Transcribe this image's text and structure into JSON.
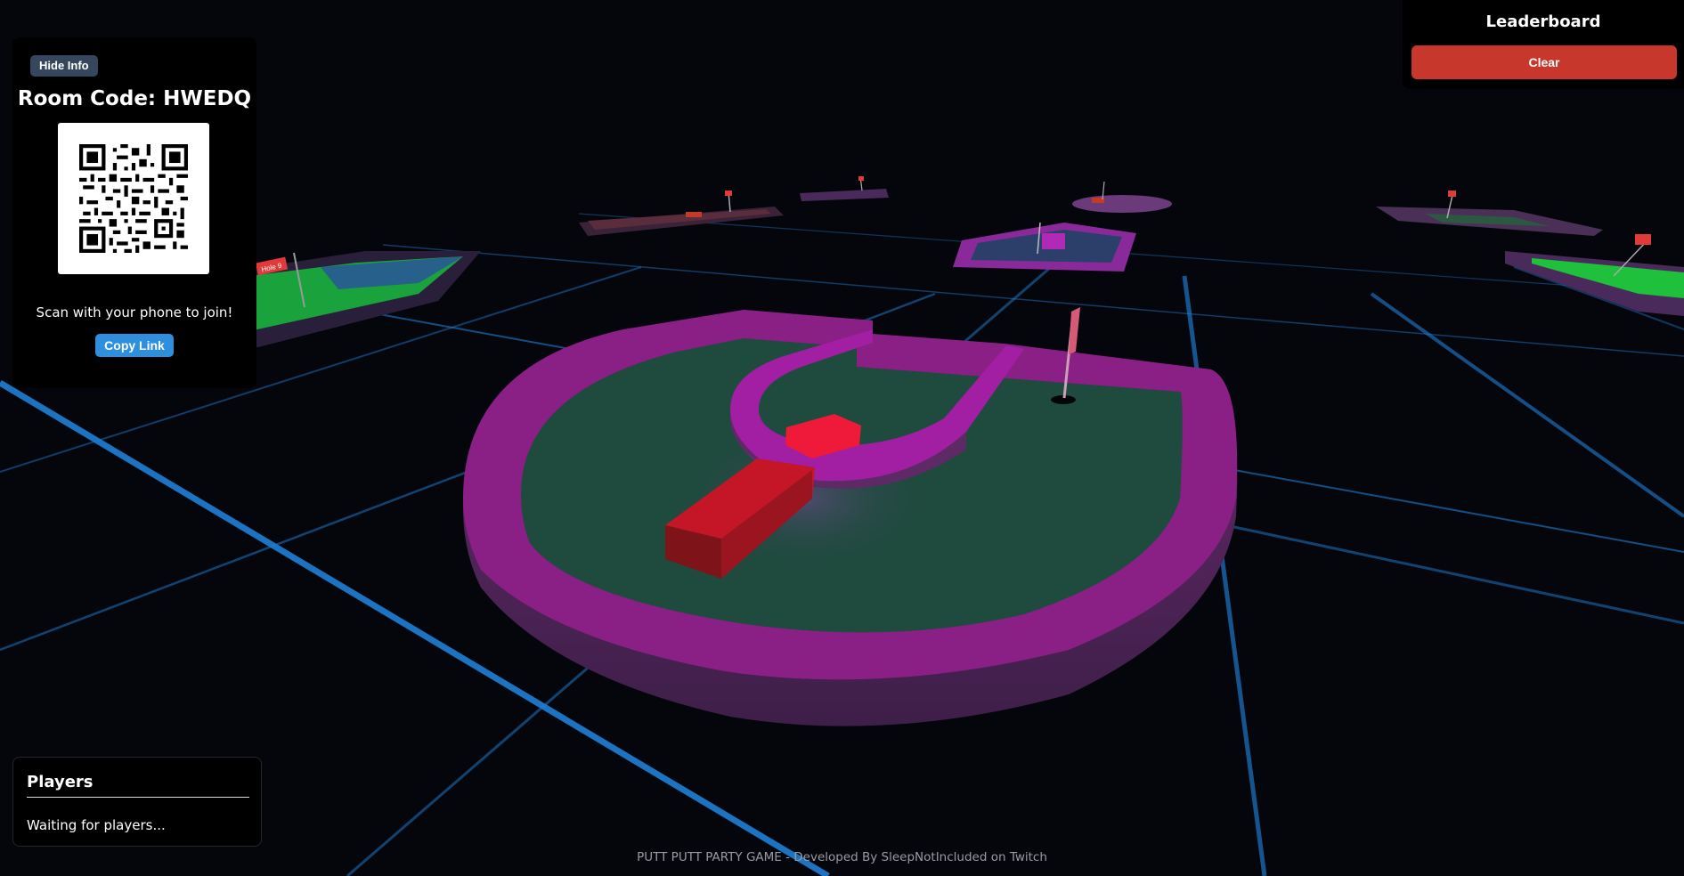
{
  "info_panel": {
    "hide_label": "Hide Info",
    "room_code_text": "Room Code: HWEDQ",
    "qr_icon": "qr-code",
    "scan_text": "Scan with your phone to join!",
    "copy_label": "Copy Link"
  },
  "leaderboard": {
    "title": "Leaderboard",
    "clear_label": "Clear"
  },
  "players": {
    "title": "Players",
    "status": "Waiting for players..."
  },
  "scene": {
    "flag_label": "Hole 9"
  },
  "footer": "PUTT PUTT PARTY GAME - Developed By SleepNotIncluded on Twitch",
  "colors": {
    "background": "#05060c",
    "grid": "#1e7fd6",
    "wall": "#8a1f86",
    "green": "#1f4a3e",
    "obstacle": "#c41626",
    "clear_button": "#c8372b",
    "copy_button": "#2d8fdd"
  }
}
